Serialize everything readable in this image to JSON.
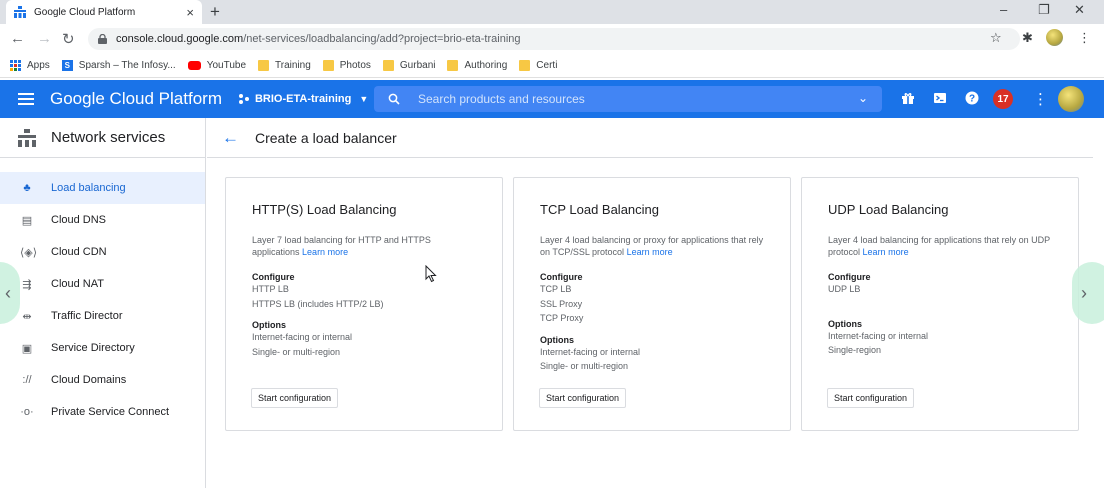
{
  "browser": {
    "tab_title": "Google Cloud Platform",
    "tab_close": "×",
    "new_tab": "+",
    "url_host": "console.cloud.google.com",
    "url_path": "/net-services/loadbalancing/add?project=brio-eta-training",
    "bookmarks": [
      "Apps",
      "Sparsh – The Infosy...",
      "YouTube",
      "Training",
      "Photos",
      "Gurbani",
      "Authoring",
      "Certi"
    ]
  },
  "gcp": {
    "title": "Google Cloud Platform",
    "project": "BRIO-ETA-training",
    "search_placeholder": "Search products and resources",
    "notifications": "17",
    "brand_color": "#1a73e8"
  },
  "sidebar": {
    "title": "Network services",
    "items": [
      {
        "label": "Load balancing",
        "icon": "load-balancing-icon",
        "active": true
      },
      {
        "label": "Cloud DNS",
        "icon": "dns-icon"
      },
      {
        "label": "Cloud CDN",
        "icon": "cdn-icon"
      },
      {
        "label": "Cloud NAT",
        "icon": "nat-icon"
      },
      {
        "label": "Traffic Director",
        "icon": "traffic-director-icon"
      },
      {
        "label": "Service Directory",
        "icon": "service-directory-icon"
      },
      {
        "label": "Cloud Domains",
        "icon": "domains-icon"
      },
      {
        "label": "Private Service Connect",
        "icon": "private-connect-icon"
      }
    ]
  },
  "main": {
    "title": "Create a load balancer",
    "cards": [
      {
        "title": "HTTP(S) Load Balancing",
        "desc": "Layer 7 load balancing for HTTP and HTTPS applications",
        "learn_more": "Learn more",
        "configure_label": "Configure",
        "configure": [
          "HTTP LB",
          "HTTPS LB (includes HTTP/2 LB)"
        ],
        "options_label": "Options",
        "options": [
          "Internet-facing or internal",
          "Single- or multi-region"
        ],
        "button": "Start configuration"
      },
      {
        "title": "TCP Load Balancing",
        "desc": "Layer 4 load balancing or proxy for applications that rely on TCP/SSL protocol",
        "learn_more": "Learn more",
        "configure_label": "Configure",
        "configure": [
          "TCP LB",
          "SSL Proxy",
          "TCP Proxy"
        ],
        "options_label": "Options",
        "options": [
          "Internet-facing or internal",
          "Single- or multi-region"
        ],
        "button": "Start configuration"
      },
      {
        "title": "UDP Load Balancing",
        "desc": "Layer 4 load balancing for applications that rely on UDP protocol",
        "learn_more": "Learn more",
        "configure_label": "Configure",
        "configure": [
          "UDP LB"
        ],
        "options_label": "Options",
        "options": [
          "Internet-facing or internal",
          "Single-region"
        ],
        "button": "Start configuration"
      }
    ]
  }
}
